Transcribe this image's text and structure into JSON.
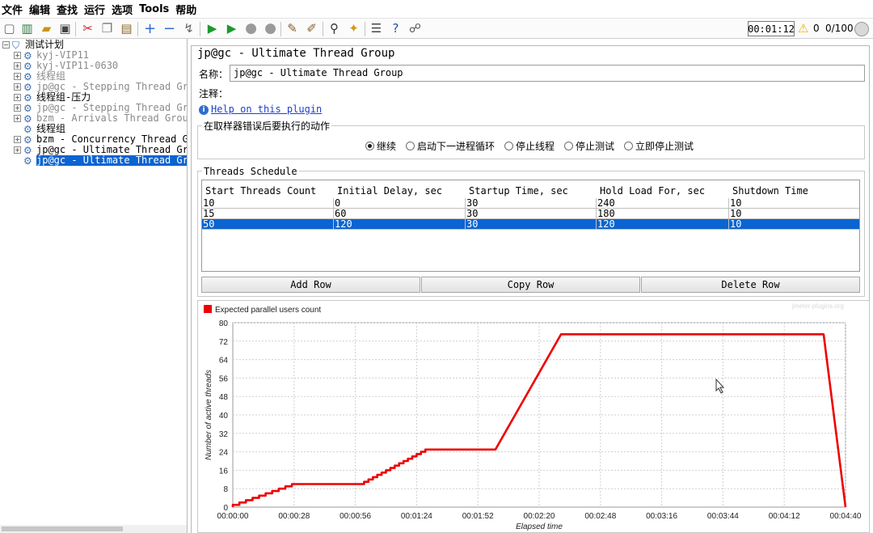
{
  "menu": [
    "文件",
    "编辑",
    "查找",
    "运行",
    "选项",
    "Tools",
    "帮助"
  ],
  "toolbar": {
    "icons": [
      "new-icon",
      "templates-icon",
      "open-icon",
      "save-icon",
      "cut-icon",
      "copy-icon",
      "paste-icon",
      "expand-icon",
      "collapse-icon",
      "toggle-icon",
      "start-icon",
      "start-no-pause-icon",
      "stop-icon",
      "shutdown-icon",
      "clear-icon",
      "clear-all-icon",
      "search-icon",
      "reset-search-icon",
      "function-helper-icon",
      "help-icon",
      "remote-icon"
    ],
    "timer": "00:01:12",
    "warnings": "0",
    "threads": "0/100"
  },
  "tree": {
    "root": "测试计划",
    "items": [
      {
        "label": "kyj-VIP11",
        "gray": true,
        "expand": "+"
      },
      {
        "label": "kyj-VIP11-0630",
        "gray": true,
        "expand": "+"
      },
      {
        "label": "线程组",
        "gray": true,
        "expand": "+"
      },
      {
        "label": "jp@gc - Stepping Thread Grou",
        "gray": true,
        "expand": "+"
      },
      {
        "label": "线程组-压力",
        "gray": false,
        "expand": "+"
      },
      {
        "label": "jp@gc - Stepping Thread Grou",
        "gray": true,
        "expand": "+"
      },
      {
        "label": "bzm - Arrivals Thread Group",
        "gray": true,
        "expand": "+"
      },
      {
        "label": "线程组",
        "gray": false,
        "expand": ""
      },
      {
        "label": "bzm - Concurrency Thread Gro",
        "gray": false,
        "expand": "+"
      },
      {
        "label": "jp@gc - Ultimate Thread Grou",
        "gray": false,
        "expand": "+"
      },
      {
        "label": "jp@gc - Ultimate Thread Grou",
        "gray": false,
        "expand": "",
        "selected": true
      }
    ]
  },
  "panel": {
    "title": "jp@gc - Ultimate Thread Group",
    "name_label": "名称：",
    "name_value": "jp@gc - Ultimate Thread Group",
    "comment_label": "注释：",
    "help_link": "Help on this plugin"
  },
  "action": {
    "title": "在取样器错误后要执行的动作",
    "options": [
      "继续",
      "启动下一进程循环",
      "停止线程",
      "停止测试",
      "立即停止测试"
    ],
    "selected": 0
  },
  "schedule": {
    "title": "Threads Schedule",
    "columns": [
      "Start Threads Count",
      "Initial Delay, sec",
      "Startup Time, sec",
      "Hold Load For, sec",
      "Shutdown Time"
    ],
    "rows": [
      [
        "10",
        "0",
        "30",
        "240",
        "10"
      ],
      [
        "15",
        "60",
        "30",
        "180",
        "10"
      ],
      [
        "50",
        "120",
        "30",
        "120",
        "10"
      ]
    ],
    "selected_row": 2,
    "buttons": {
      "add": "Add Row",
      "copy": "Copy Row",
      "delete": "Delete Row"
    }
  },
  "chart_data": {
    "type": "line",
    "legend": "Expected parallel users count",
    "watermark": "jmeter-plugins.org",
    "xlabel": "Elapsed time",
    "ylabel": "Number of active threads",
    "xlim": [
      0,
      280
    ],
    "ylim": [
      0,
      80
    ],
    "xticks": [
      0,
      28,
      56,
      84,
      112,
      140,
      168,
      196,
      224,
      252,
      280
    ],
    "xtick_labels": [
      "00:00:00",
      "00:00:28",
      "00:00:56",
      "00:01:24",
      "00:01:52",
      "00:02:20",
      "00:02:48",
      "00:03:16",
      "00:03:44",
      "00:04:12",
      "00:04:40"
    ],
    "yticks": [
      0,
      8,
      16,
      24,
      32,
      40,
      48,
      56,
      64,
      72,
      80
    ],
    "grid": true,
    "series": [
      {
        "name": "Expected parallel users count",
        "color": "#ee0000",
        "x": [
          0,
          30,
          60,
          90,
          120,
          150,
          270,
          280
        ],
        "y": [
          0,
          10,
          10,
          25,
          25,
          75,
          75,
          0
        ],
        "stepped_until_x": 90
      }
    ]
  }
}
